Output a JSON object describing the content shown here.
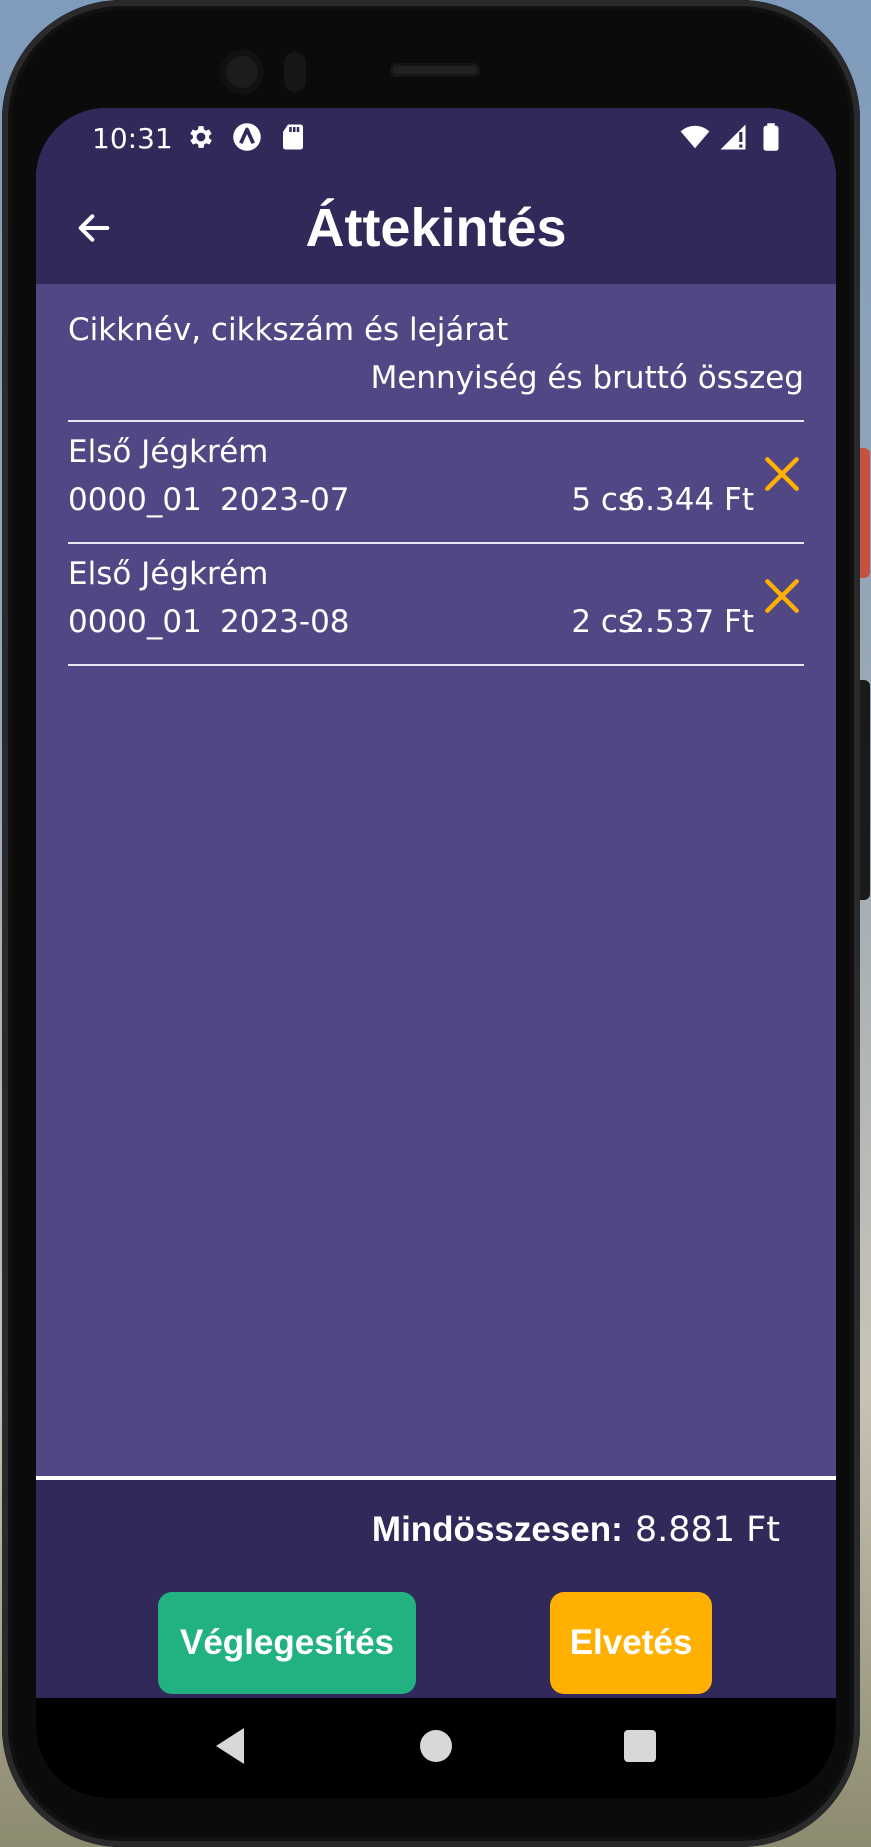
{
  "status_bar": {
    "time": "10:31",
    "left_icons": [
      "gear-icon",
      "app-a-icon",
      "sd-card-icon"
    ],
    "right_icons": [
      "wifi-icon",
      "signal-icon",
      "battery-icon"
    ]
  },
  "app_bar": {
    "title": "Áttekintés",
    "back_icon": "arrow-left-icon"
  },
  "list_header": {
    "col1": "Cikknév, cikkszám és lejárat",
    "col2": "Mennyiség és bruttó összeg"
  },
  "items": [
    {
      "name": "Első Jégkrém",
      "sku": "0000_01",
      "expiry": "2023-07",
      "quantity": "5 cs.",
      "amount": "6.344 Ft"
    },
    {
      "name": "Első Jégkrém",
      "sku": "0000_01",
      "expiry": "2023-08",
      "quantity": "2 cs.",
      "amount": "2.537 Ft"
    }
  ],
  "footer": {
    "total_label": "Mindösszesen:",
    "total_value": "8.881 Ft",
    "finalize_label": "Véglegesítés",
    "discard_label": "Elvetés"
  },
  "colors": {
    "app_bar": "#30295a",
    "content_bg": "#514784",
    "remove_icon": "#ffb000",
    "finalize_button": "#22b282",
    "discard_button": "#ffb000"
  }
}
